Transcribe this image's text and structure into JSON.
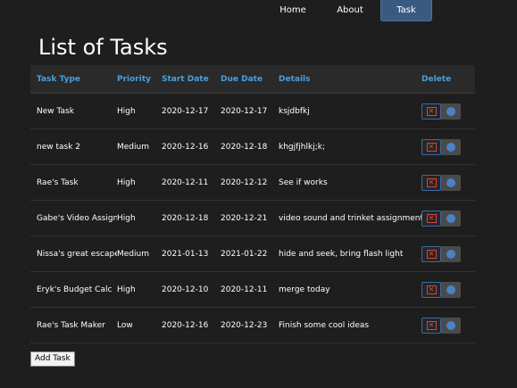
{
  "nav": {
    "home": "Home",
    "about": "About",
    "task": "Task"
  },
  "page_title": "List of Tasks",
  "table": {
    "headers": {
      "task_type": "Task Type",
      "priority": "Priority",
      "start_date": "Start Date",
      "due_date": "Due Date",
      "details": "Details",
      "delete": "Delete"
    },
    "rows": [
      {
        "task_type": "New Task",
        "priority": "High",
        "start_date": "2020-12-17",
        "due_date": "2020-12-17",
        "details": "ksjdbfkj"
      },
      {
        "task_type": "new task 2",
        "priority": "Medium",
        "start_date": "2020-12-16",
        "due_date": "2020-12-18",
        "details": "khgjfjhlkj;k;"
      },
      {
        "task_type": "Rae's Task",
        "priority": "High",
        "start_date": "2020-12-11",
        "due_date": "2020-12-12",
        "details": "See if works"
      },
      {
        "task_type": "Gabe's Video Assign",
        "priority": "High",
        "start_date": "2020-12-18",
        "due_date": "2020-12-21",
        "details": "video sound and trinket assignment"
      },
      {
        "task_type": "Nissa's great escape",
        "priority": "Medium",
        "start_date": "2021-01-13",
        "due_date": "2021-01-22",
        "details": "hide and seek, bring flash light"
      },
      {
        "task_type": "Eryk's Budget Calc",
        "priority": "High",
        "start_date": "2020-12-10",
        "due_date": "2020-12-11",
        "details": "merge today"
      },
      {
        "task_type": "Rae's Task Maker",
        "priority": "Low",
        "start_date": "2020-12-16",
        "due_date": "2020-12-23",
        "details": "Finish some cool ideas"
      }
    ]
  },
  "add_task_label": "Add Task",
  "icons": {
    "delete": "close-x-icon",
    "edit": "gear-icon"
  },
  "colors": {
    "background": "#1e1e1e",
    "header_text": "#4b9fde",
    "active_nav": "#3b5a82",
    "delete_red": "#d9453a"
  }
}
